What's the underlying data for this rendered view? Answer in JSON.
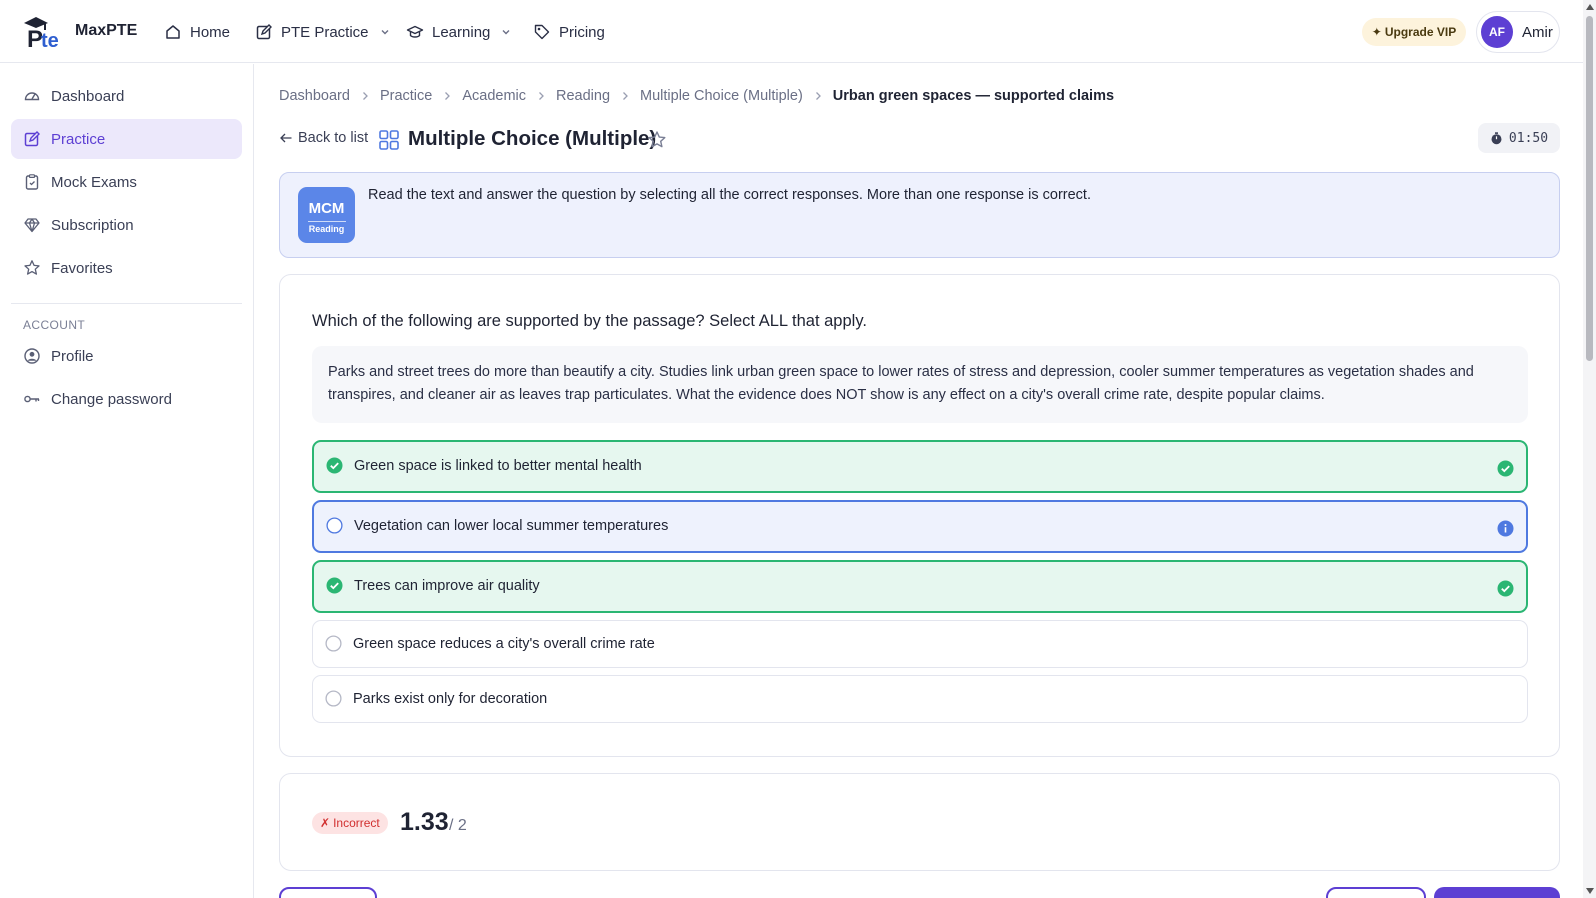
{
  "brand": {
    "name": "MaxPTE"
  },
  "nav": {
    "home": "Home",
    "pte_practice": "PTE Practice",
    "learning": "Learning",
    "pricing": "Pricing",
    "upgrade": "Upgrade VIP",
    "user_initials": "AF",
    "user_name": "Amir"
  },
  "sidebar": {
    "items": [
      {
        "label": "Dashboard",
        "icon": "gauge-icon"
      },
      {
        "label": "Practice",
        "icon": "edit-icon",
        "active": true
      },
      {
        "label": "Mock Exams",
        "icon": "clipboard-icon"
      },
      {
        "label": "Subscription",
        "icon": "diamond-icon"
      },
      {
        "label": "Favorites",
        "icon": "star-icon"
      }
    ],
    "account_heading": "ACCOUNT",
    "account_items": [
      {
        "label": "Profile",
        "icon": "user-circle-icon"
      },
      {
        "label": "Change password",
        "icon": "key-icon"
      }
    ]
  },
  "breadcrumb": [
    "Dashboard",
    "Practice",
    "Academic",
    "Reading",
    "Multiple Choice (Multiple)",
    "Urban green spaces — supported claims"
  ],
  "header": {
    "back": "Back to list",
    "title": "Multiple Choice (Multiple)",
    "timer": "01:50"
  },
  "instruction": {
    "badge_top": "MCM",
    "badge_bottom": "Reading",
    "text": "Read the text and answer the question by selecting all the correct responses. More than one response is correct."
  },
  "question": {
    "prompt": "Which of the following are supported by the passage? Select ALL that apply.",
    "passage": "Parks and street trees do more than beautify a city. Studies link urban green space to lower rates of stress and depression, cooler summer temperatures as vegetation shades and transpires, and cleaner air as leaves trap particulates. What the evidence does NOT show is any effect on a city's overall crime rate, despite popular claims.",
    "options": [
      {
        "label": "Green space is linked to better mental health",
        "selected": true,
        "state": "correct"
      },
      {
        "label": "Vegetation can lower local summer temperatures",
        "selected": false,
        "state": "missed"
      },
      {
        "label": "Trees can improve air quality",
        "selected": true,
        "state": "correct"
      },
      {
        "label": "Green space reduces a city's overall crime rate",
        "selected": false,
        "state": "neutral"
      },
      {
        "label": "Parks exist only for decoration",
        "selected": false,
        "state": "neutral"
      }
    ]
  },
  "result": {
    "status": "Incorrect",
    "status_mark": "✗",
    "score": "1.33",
    "total": "/ 2"
  },
  "colors": {
    "accent": "#5d3fd3",
    "correct": "#2bb673",
    "missed": "#4f79e0",
    "incorrect": "#d12f2f"
  }
}
